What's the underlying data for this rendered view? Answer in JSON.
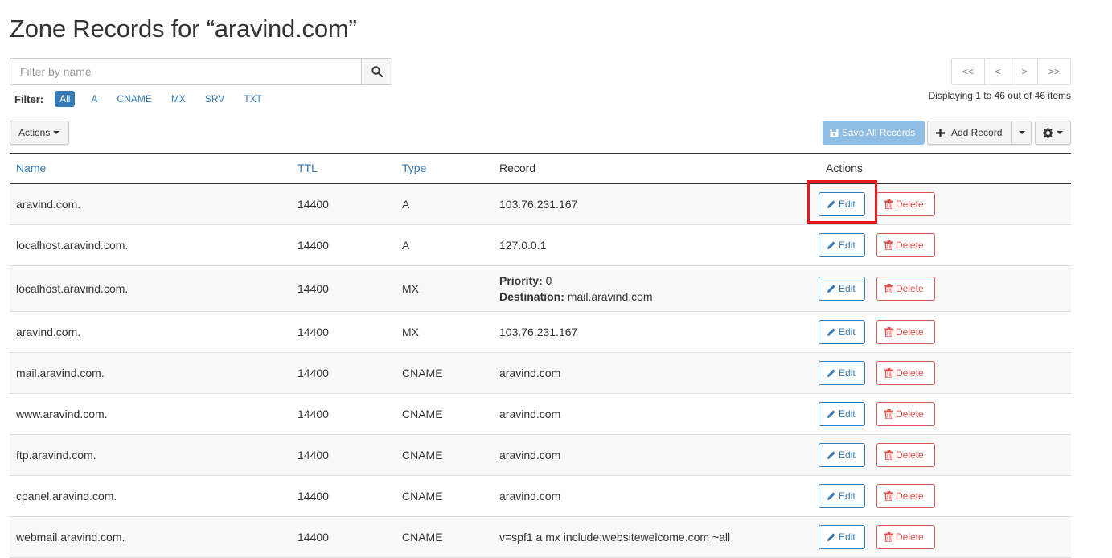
{
  "page_title": "Zone Records for “aravind.com”",
  "search": {
    "placeholder": "Filter by name",
    "icon": "search-icon"
  },
  "filter": {
    "label": "Filter:",
    "options": [
      "All",
      "A",
      "CNAME",
      "MX",
      "SRV",
      "TXT"
    ],
    "active": "All"
  },
  "pagination": {
    "first": "<<",
    "prev": "<",
    "next": ">",
    "last": ">>",
    "info": "Displaying 1 to 46 out of 46 items"
  },
  "toolbar": {
    "actions_label": "Actions",
    "save_all_label": "Save All Records",
    "add_record_label": "Add Record",
    "save_color": "#8fbde3"
  },
  "table": {
    "columns": {
      "name": "Name",
      "ttl": "TTL",
      "type": "Type",
      "record": "Record",
      "actions": "Actions"
    },
    "edit_label": "Edit",
    "delete_label": "Delete",
    "rows": [
      {
        "name": "aravind.com.",
        "ttl": "14400",
        "type": "A",
        "record": "103.76.231.167"
      },
      {
        "name": "localhost.aravind.com.",
        "ttl": "14400",
        "type": "A",
        "record": "127.0.0.1"
      },
      {
        "name": "localhost.aravind.com.",
        "ttl": "14400",
        "type": "MX",
        "priority_label": "Priority:",
        "priority": "0",
        "destination_label": "Destination:",
        "destination": "mail.aravind.com"
      },
      {
        "name": "aravind.com.",
        "ttl": "14400",
        "type": "MX",
        "record": "103.76.231.167"
      },
      {
        "name": "mail.aravind.com.",
        "ttl": "14400",
        "type": "CNAME",
        "record": "aravind.com"
      },
      {
        "name": "www.aravind.com.",
        "ttl": "14400",
        "type": "CNAME",
        "record": "aravind.com"
      },
      {
        "name": "ftp.aravind.com.",
        "ttl": "14400",
        "type": "CNAME",
        "record": "aravind.com"
      },
      {
        "name": "cpanel.aravind.com.",
        "ttl": "14400",
        "type": "CNAME",
        "record": "aravind.com"
      },
      {
        "name": "webmail.aravind.com.",
        "ttl": "14400",
        "type": "CNAME",
        "record": "v=spf1 a mx include:websitewelcome.com ~all"
      }
    ]
  },
  "colors": {
    "link": "#337ab7",
    "danger": "#d9534f",
    "highlight": "#e8151b"
  }
}
